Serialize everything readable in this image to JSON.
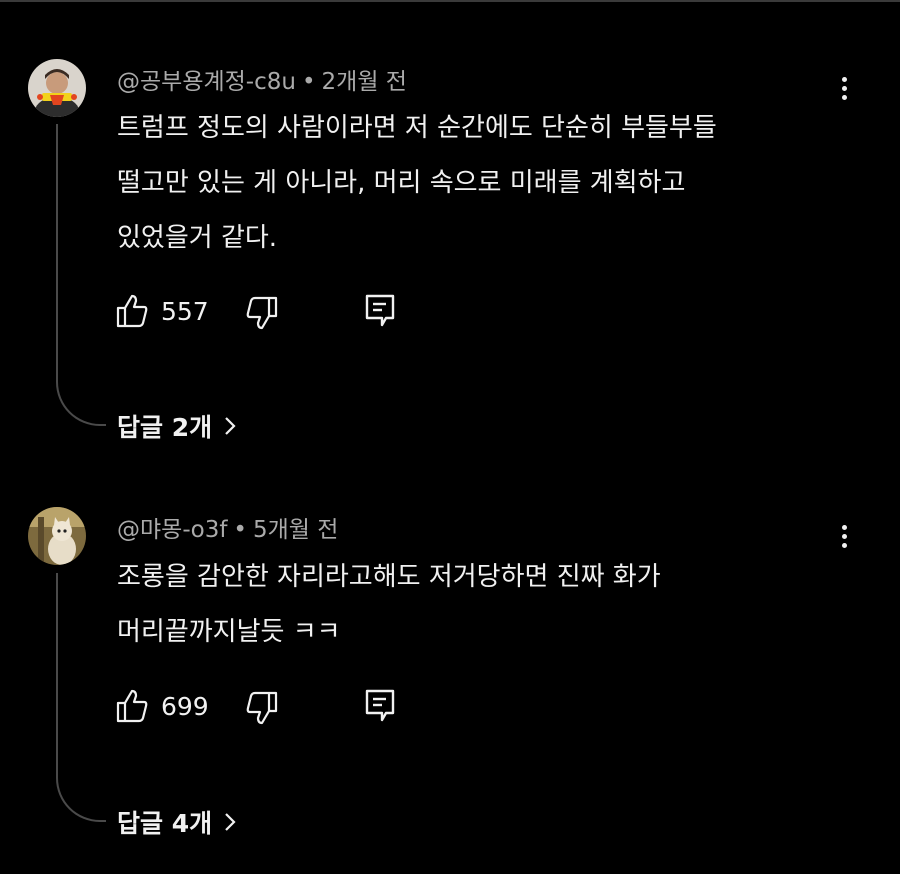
{
  "comments": [
    {
      "author": "@공부용계정-c8u",
      "time": "2개월 전",
      "lines": [
        "트럼프 정도의 사람이라면 저 순간에도 단순히 부들부들",
        "떨고만 있는 게 아니라, 머리 속으로 미래를 계획하고",
        "있었을거 같다."
      ],
      "likes": "557",
      "replies": "답글 2개",
      "avatar_icon": "person-avatar-icon"
    },
    {
      "author": "@먀몽-o3f",
      "time": "5개월 전",
      "lines": [
        "조롱을 감안한 자리라고해도 저거당하면 진짜 화가",
        "머리끝까지날듯 ㅋㅋ"
      ],
      "likes": "699",
      "replies": "답글 4개",
      "avatar_icon": "cat-avatar-icon"
    }
  ],
  "icons": {
    "like": "thumbs-up-icon",
    "dislike": "thumbs-down-icon",
    "reply": "reply-icon",
    "more": "more-vertical-icon",
    "chevron": "chevron-right-icon"
  },
  "colors": {
    "background": "#000000",
    "text": "#f1f1f1",
    "meta": "#aaaaaa",
    "thread": "#4a4a4a"
  }
}
